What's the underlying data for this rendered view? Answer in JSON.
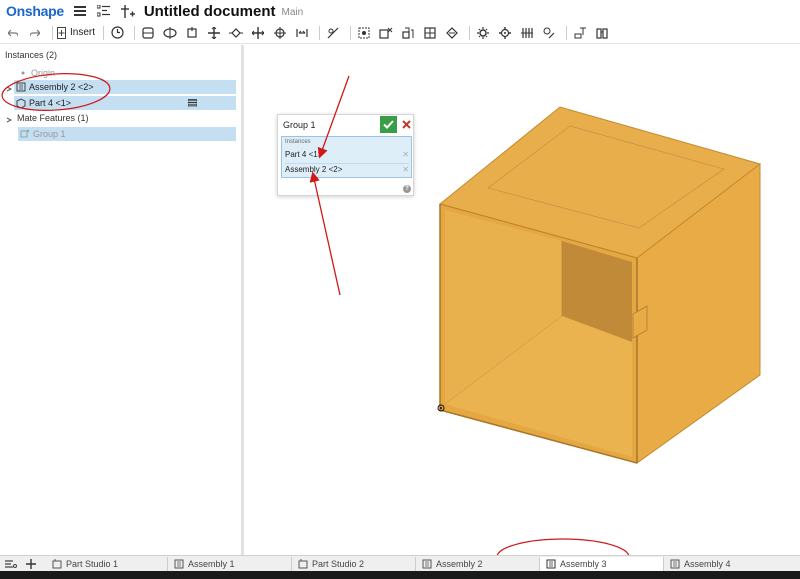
{
  "header": {
    "logo": "Onshape",
    "title": "Untitled document",
    "branch": "Main"
  },
  "toolbar": {
    "insert_label": "Insert"
  },
  "instances": {
    "heading": "Instances (2)",
    "items": [
      {
        "label": "Origin"
      },
      {
        "label": "Assembly 2 <2>"
      },
      {
        "label": "Part 4 <1>"
      }
    ]
  },
  "mates": {
    "heading": "Mate Features (1)",
    "items": [
      {
        "label": "Group 1"
      }
    ]
  },
  "dialog": {
    "title": "Group 1",
    "list_heading": "Instances",
    "items": [
      {
        "label": "Part 4 <1>"
      },
      {
        "label": "Assembly 2 <2>"
      }
    ],
    "help": "?"
  },
  "tabs": [
    {
      "label": "Part Studio 1"
    },
    {
      "label": "Assembly 1"
    },
    {
      "label": "Part Studio 2"
    },
    {
      "label": "Assembly 2"
    },
    {
      "label": "Assembly 3",
      "active": true
    },
    {
      "label": "Assembly 4"
    }
  ],
  "colors": {
    "brand": "#1a67c9",
    "selection": "#c4def2",
    "model": "#e8ac48",
    "annotation": "#d01818",
    "confirm": "#3a9d47"
  }
}
